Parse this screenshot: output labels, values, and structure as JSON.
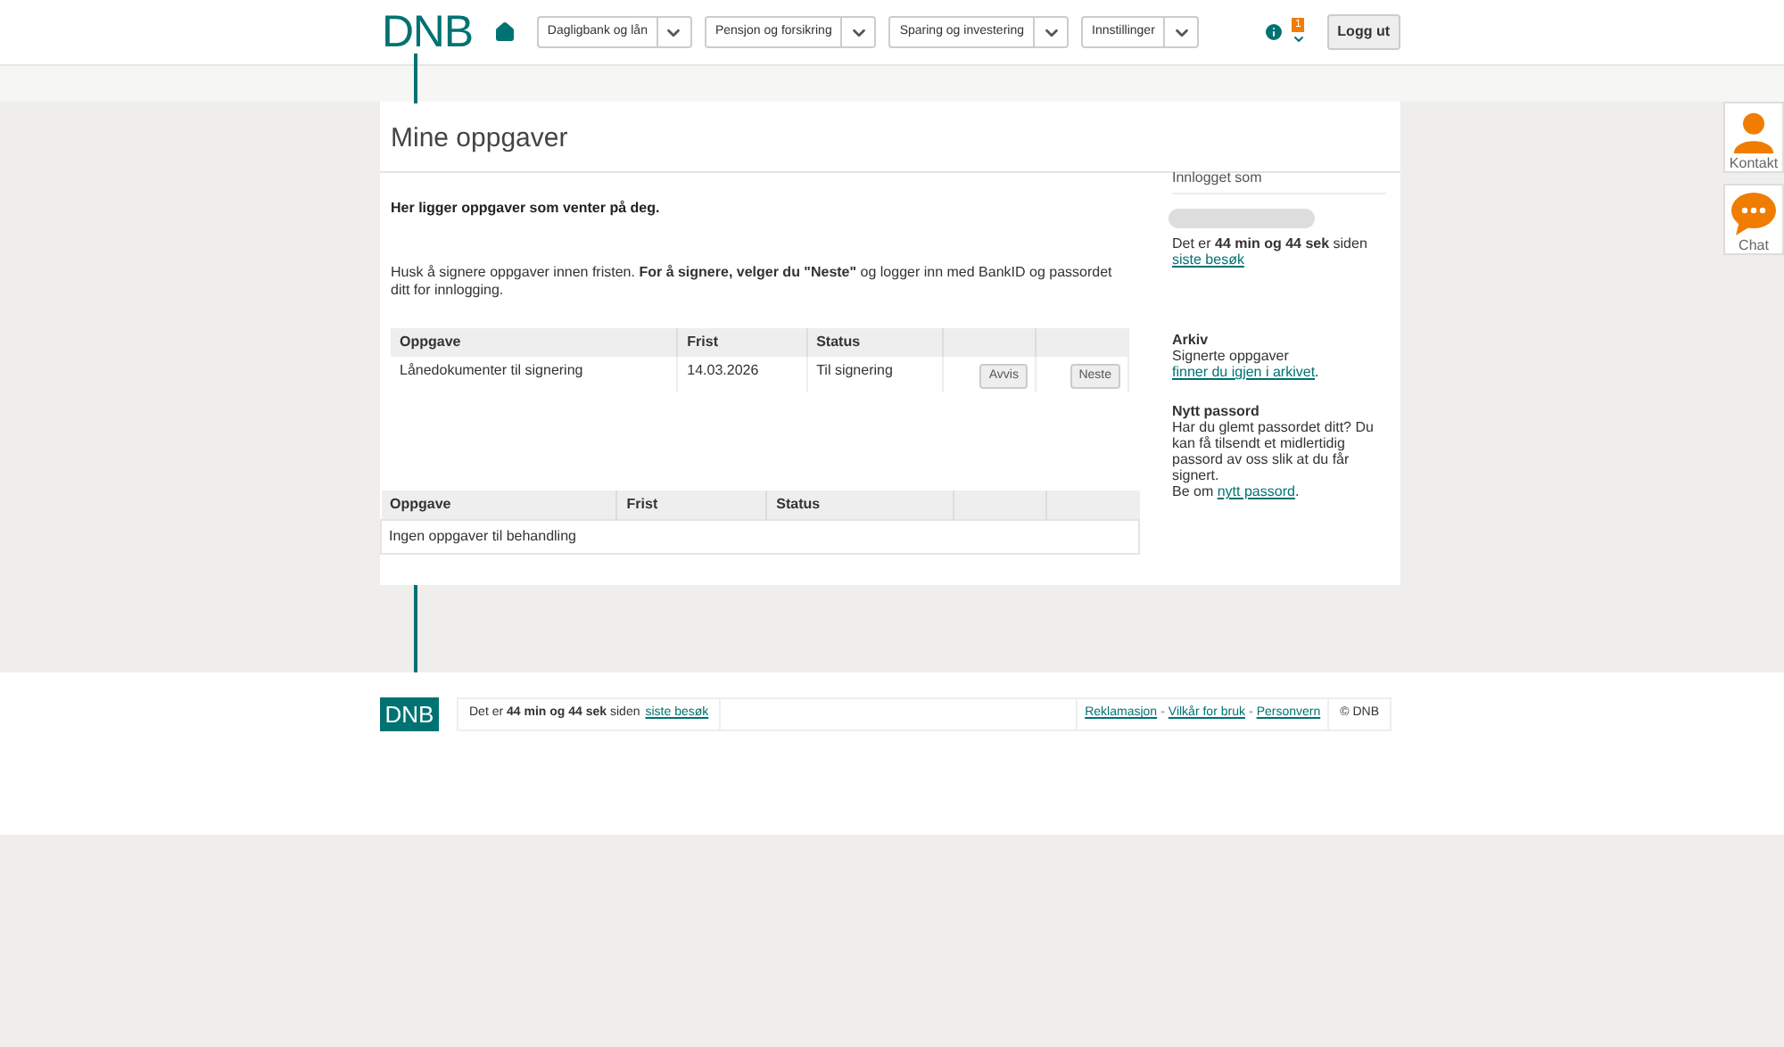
{
  "logo": "DNB",
  "nav": [
    {
      "label": "Dagligbank og lån"
    },
    {
      "label": "Pensjon og forsikring"
    },
    {
      "label": "Sparing og investering"
    },
    {
      "label": "Innstillinger"
    }
  ],
  "notification_count": "1",
  "logout": "Logg ut",
  "side_buttons": [
    {
      "kind": "contact",
      "label": "Kontakt"
    },
    {
      "kind": "chat",
      "label": "Chat"
    }
  ],
  "page_title": "Mine oppgaver",
  "intro": "Her ligger oppgaver som venter på deg.",
  "reminder": "Husk å signere oppgaver innen fristen. **For å signere, velger du \"Neste\"** og logger inn med BankID og passordet ditt for innlogging.",
  "pending_table": {
    "columns": [
      "Oppgave",
      "Frist",
      "Status"
    ],
    "rows": [
      {
        "cells": [
          "Lånedokumenter til signering",
          "14.03.2026",
          "Til signering"
        ],
        "actions": [
          "Avvis",
          "Neste"
        ]
      }
    ]
  },
  "done_table": {
    "columns": [
      "Oppgave",
      "Frist",
      "Status"
    ],
    "empty": "Ingen oppgaver til behandling"
  },
  "sidebar": {
    "logged_in_title": "Innlogget som",
    "last_visit": {
      "text": "Det er **44 min og 44 sek** siden",
      "link": "siste besøk"
    },
    "archive": {
      "title": "Arkiv",
      "text": "Signerte oppgaver",
      "link": "finner du igjen i arkivet",
      "end": "."
    },
    "password": {
      "title": "Nytt passord",
      "text": "Har du glemt passordet ditt? Du kan få tilsendt et midlertidig passord av oss slik at du får signert.",
      "text2": "Be om",
      "link": "nytt passord",
      "end": "."
    }
  },
  "footer": {
    "logo": "DNB",
    "last_visit": {
      "text": "Det er **44 min og 44 sek** siden",
      "link": "siste besøk"
    },
    "links": [
      "Reklamasjon",
      "Vilkår for bruk",
      "Personvern"
    ],
    "separator": "-",
    "copyright": "© DNB"
  }
}
